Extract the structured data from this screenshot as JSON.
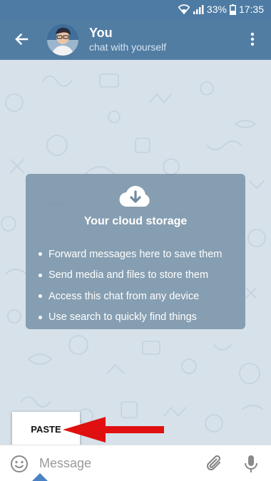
{
  "status_bar": {
    "battery": "33%",
    "time": "17:35",
    "icons": [
      "wifi-icon",
      "signal-icon",
      "battery-icon"
    ]
  },
  "header": {
    "title": "You",
    "subtitle": "chat with yourself",
    "icons": [
      "back-arrow-icon",
      "avatar",
      "more-vert-icon"
    ]
  },
  "cloud_card": {
    "title": "Your cloud storage",
    "icon": "cloud-download-icon",
    "items": [
      "Forward messages here to save them",
      "Send media and files to store them",
      "Access this chat from any device",
      "Use search to quickly find things"
    ]
  },
  "context_menu": {
    "paste_label": "PASTE"
  },
  "composer": {
    "placeholder": "Message",
    "icons": [
      "emoji-icon",
      "attach-icon",
      "mic-icon"
    ]
  },
  "colors": {
    "header": "#527da3",
    "status_bar": "#4e7ba3",
    "chat_background": "#d6e1ea",
    "card": "#708aa0",
    "annotation_arrow": "#e01010",
    "caret_handle": "#4a82c4"
  }
}
